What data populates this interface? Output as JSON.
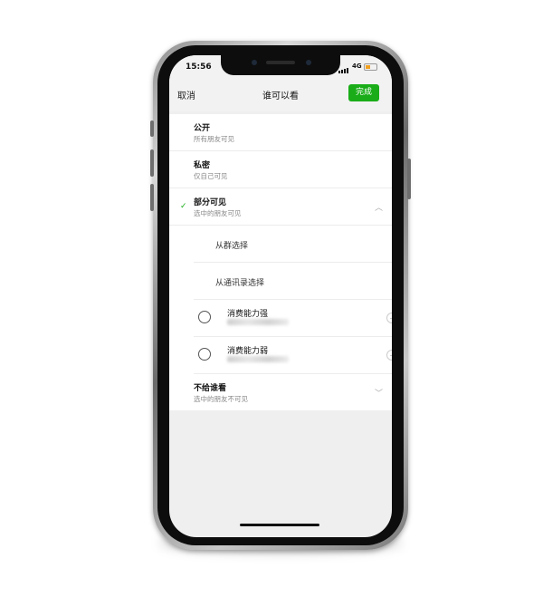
{
  "status_bar": {
    "time": "15:56",
    "network": "4G"
  },
  "nav": {
    "cancel_label": "取消",
    "title": "谁可以看",
    "done_label": "完成"
  },
  "options": [
    {
      "title": "公开",
      "subtitle": "所有朋友可见"
    },
    {
      "title": "私密",
      "subtitle": "仅自己可见"
    },
    {
      "title": "部分可见",
      "subtitle": "选中的朋友可见",
      "selected": true,
      "expanded": true
    },
    {
      "title": "不给谁看",
      "subtitle": "选中的朋友不可见",
      "expanded": false
    }
  ],
  "partial_sub_options": [
    "从群选择",
    "从通讯录选择"
  ],
  "tags": [
    {
      "name": "消费能力强",
      "selected": false
    },
    {
      "name": "消费能力弱",
      "selected": false
    }
  ],
  "icons": {
    "check": "checkmark-icon",
    "chevron_up": "chevron-up-icon",
    "chevron_down": "chevron-down-icon",
    "more": "more-circle-icon"
  },
  "colors": {
    "accent": "#1aad19",
    "background": "#efefef",
    "battery": "#f0a020"
  }
}
